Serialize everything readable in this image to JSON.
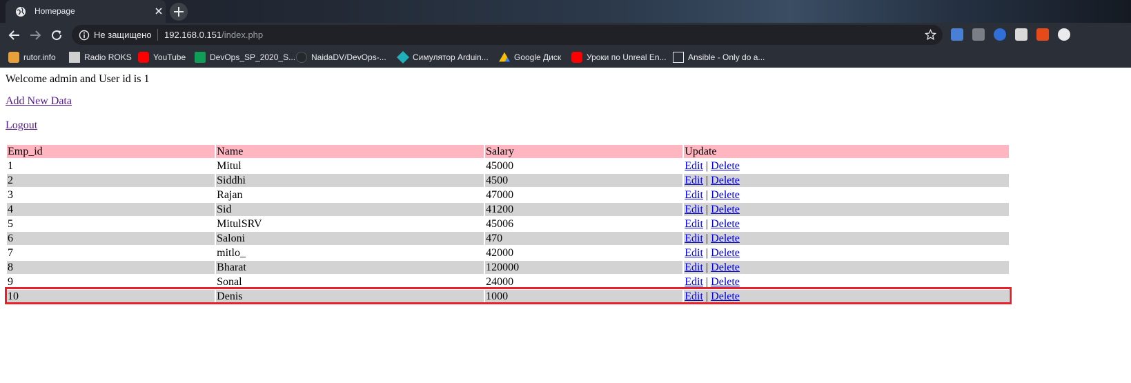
{
  "browser": {
    "tab": {
      "title": "Homepage"
    },
    "omnibox": {
      "security_label": "Не защищено",
      "url_host": "192.168.0.151",
      "url_path": "/index.php"
    },
    "bookmarks": [
      {
        "label": "rutor.info",
        "icon": "rutor-icon",
        "color": "#e8a13a"
      },
      {
        "label": "Radio ROKS",
        "icon": "radio-roks-icon",
        "color": "#cfcfcf"
      },
      {
        "label": "YouTube",
        "icon": "youtube-icon",
        "color": "#ff0000"
      },
      {
        "label": "DevOps_SP_2020_S...",
        "icon": "google-sheets-icon",
        "color": "#0f9d58"
      },
      {
        "label": "NaidaDV/DevOps-...",
        "icon": "github-icon",
        "color": "#24292e"
      },
      {
        "label": "Симулятор Arduin...",
        "icon": "tinkercad-icon",
        "color": "#1fb0b8"
      },
      {
        "label": "Google Диск",
        "icon": "google-drive-icon",
        "color": "#fbbc04"
      },
      {
        "label": "Уроки по Unreal En...",
        "icon": "youtube-icon",
        "color": "#ff0000"
      },
      {
        "label": "Ansible - Only do a...",
        "icon": "blank-page-icon",
        "color": "#ffffff"
      }
    ]
  },
  "page": {
    "welcome": "Welcome admin and User id is 1",
    "add_link": "Add New Data",
    "logout_link": "Logout",
    "table": {
      "headers": [
        "Emp_id",
        "Name",
        "Salary",
        "Update"
      ],
      "rows": [
        {
          "id": "1",
          "name": "Mitul",
          "salary": "45000"
        },
        {
          "id": "2",
          "name": "Siddhi",
          "salary": "4500"
        },
        {
          "id": "3",
          "name": "Rajan",
          "salary": "47000"
        },
        {
          "id": "4",
          "name": "Sid",
          "salary": "41200"
        },
        {
          "id": "5",
          "name": "MitulSRV",
          "salary": "45006"
        },
        {
          "id": "6",
          "name": "Saloni",
          "salary": "470"
        },
        {
          "id": "7",
          "name": "mitlo_",
          "salary": "42000"
        },
        {
          "id": "8",
          "name": "Bharat",
          "salary": "120000"
        },
        {
          "id": "9",
          "name": "Sonal",
          "salary": "24000"
        },
        {
          "id": "10",
          "name": "Denis",
          "salary": "1000"
        }
      ],
      "edit_label": "Edit",
      "separator": "|",
      "delete_label": "Delete"
    },
    "highlight_color": "#e8202a"
  }
}
